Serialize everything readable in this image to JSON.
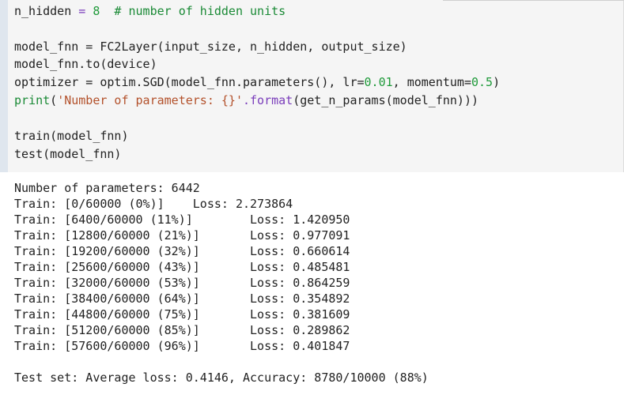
{
  "code": {
    "line1_var": "n_hidden",
    "line1_op": " = ",
    "line1_num": "8",
    "line1_comment": "  # number of hidden units",
    "line2": "model_fnn = FC2Layer(input_size, n_hidden, output_size)",
    "line3": "model_fnn.to(device)",
    "line4_a": "optimizer = optim.SGD(model_fnn.parameters(), lr=",
    "line4_lr": "0.01",
    "line4_b": ", momentum=",
    "line4_mom": "0.5",
    "line4_c": ")",
    "line5_print": "print",
    "line5_open": "(",
    "line5_str": "'Number of parameters: {}'",
    "line5_fmt": ".format",
    "line5_rest": "(get_n_params(model_fnn)))",
    "line6": "train(model_fnn)",
    "line7": "test(model_fnn)"
  },
  "output": {
    "lines": [
      "Number of parameters: 6442",
      "Train: [0/60000 (0%)]    Loss: 2.273864",
      "Train: [6400/60000 (11%)]        Loss: 1.420950",
      "Train: [12800/60000 (21%)]       Loss: 0.977091",
      "Train: [19200/60000 (32%)]       Loss: 0.660614",
      "Train: [25600/60000 (43%)]       Loss: 0.485481",
      "Train: [32000/60000 (53%)]       Loss: 0.864259",
      "Train: [38400/60000 (64%)]       Loss: 0.354892",
      "Train: [44800/60000 (75%)]       Loss: 0.381609",
      "Train: [51200/60000 (85%)]       Loss: 0.289862",
      "Train: [57600/60000 (96%)]       Loss: 0.401847"
    ],
    "test_line": "Test set: Average loss: 0.4146, Accuracy: 8780/10000 (88%)"
  }
}
